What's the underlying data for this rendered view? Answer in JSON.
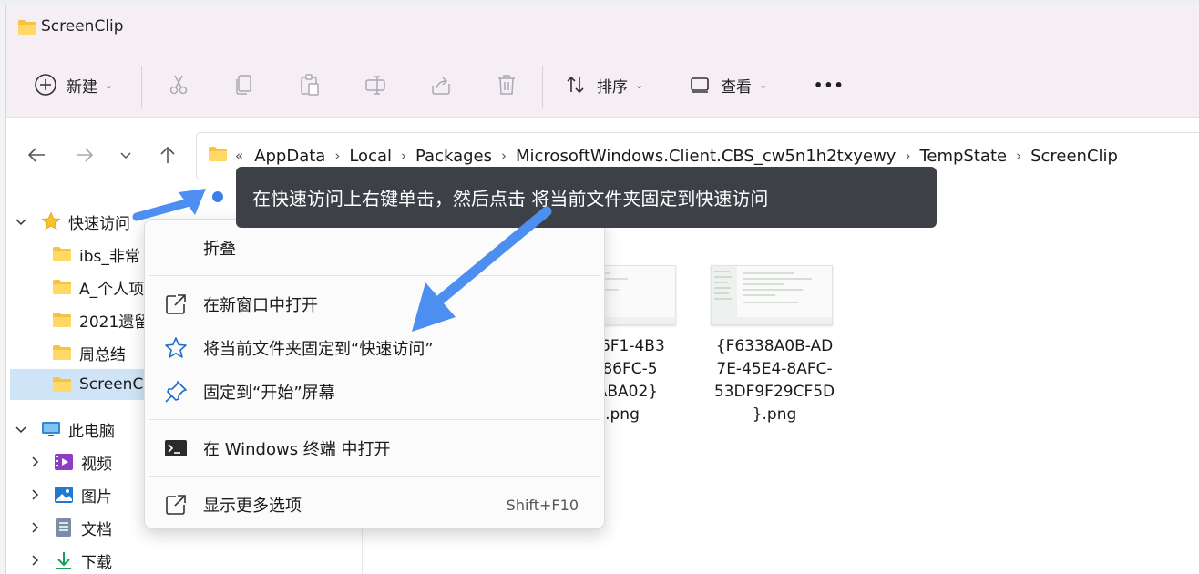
{
  "window": {
    "title": "ScreenClip"
  },
  "toolbar": {
    "new_label": "新建",
    "sort_label": "排序",
    "view_label": "查看",
    "more_label": "•••"
  },
  "address": {
    "overflow": "«",
    "crumbs": [
      "AppData",
      "Local",
      "Packages",
      "MicrosoftWindows.Client.CBS_cw5n1h2txyewy",
      "TempState",
      "ScreenClip"
    ],
    "separator": "›"
  },
  "sidebar": {
    "quick_access": "快速访问",
    "pinned": [
      "ibs_非常",
      "A_个人项",
      "2021遗留",
      "周总结",
      "ScreenC"
    ],
    "this_pc": "此电脑",
    "pc_items": [
      "视频",
      "图片",
      "文档",
      "下载"
    ]
  },
  "files": [
    {
      "name": "{C6F1-4B3\n2-86FC-5\n0ABA02}\n.png"
    },
    {
      "name": "{F6338A0B-AD\n7E-45E4-8AFC-\n53DF9F29CF5D\n}.png"
    }
  ],
  "context_menu": {
    "collapse": "折叠",
    "open_new_window": "在新窗口中打开",
    "pin_quick_access": "将当前文件夹固定到“快速访问”",
    "pin_start": "固定到“开始”屏幕",
    "open_terminal": "在 Windows 终端 中打开",
    "show_more": "显示更多选项",
    "show_more_shortcut": "Shift+F10"
  },
  "tooltip": {
    "text": "在快速访问上右键单击，然后点击 将当前文件夹固定到快速访问"
  },
  "colors": {
    "accent": "#3a7fe8",
    "selection": "#cfe4f6",
    "titlebar": "#f5eef5",
    "tooltip_bg": "#3d4147"
  }
}
